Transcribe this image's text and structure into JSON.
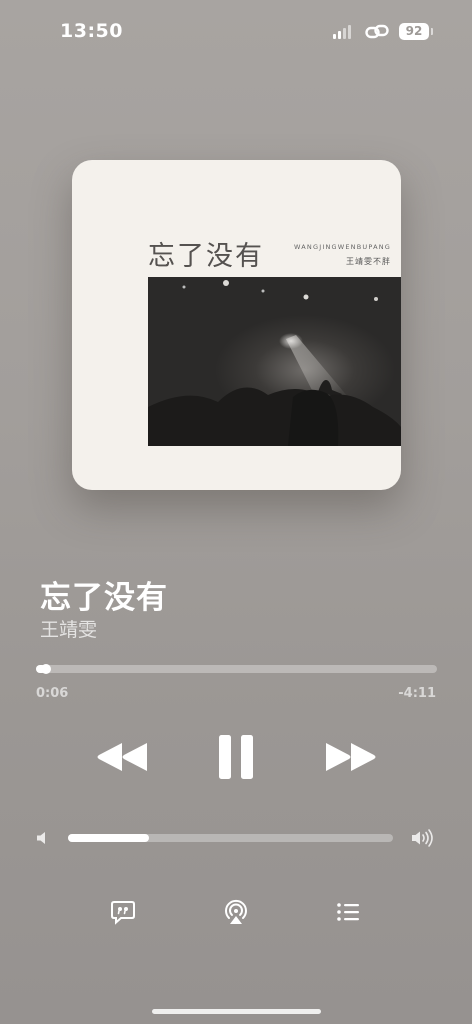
{
  "status_bar": {
    "time": "13:50",
    "battery": "92",
    "icons": [
      "signal-icon",
      "link-icon",
      "battery-icon"
    ]
  },
  "artwork": {
    "title": "忘了没有",
    "subtitle": "WANGJINGWENBUPANG",
    "artist": "王靖雯不胖"
  },
  "song": {
    "title": "忘了没有",
    "artist": "王靖雯"
  },
  "playback": {
    "elapsed": "0:06",
    "remaining": "-4:11",
    "progress_fraction": 0.024,
    "state": "playing"
  },
  "volume": {
    "level_fraction": 0.25
  },
  "controls": {
    "rewind": "rewind-icon",
    "pause": "pause-icon",
    "forward": "fast-forward-icon",
    "lyrics": "lyrics-quote-icon",
    "airplay": "airplay-icon",
    "queue": "queue-list-icon"
  },
  "colors": {
    "background": "#a29e9b",
    "foreground": "#ffffff",
    "art_background": "#f4f1ec"
  }
}
